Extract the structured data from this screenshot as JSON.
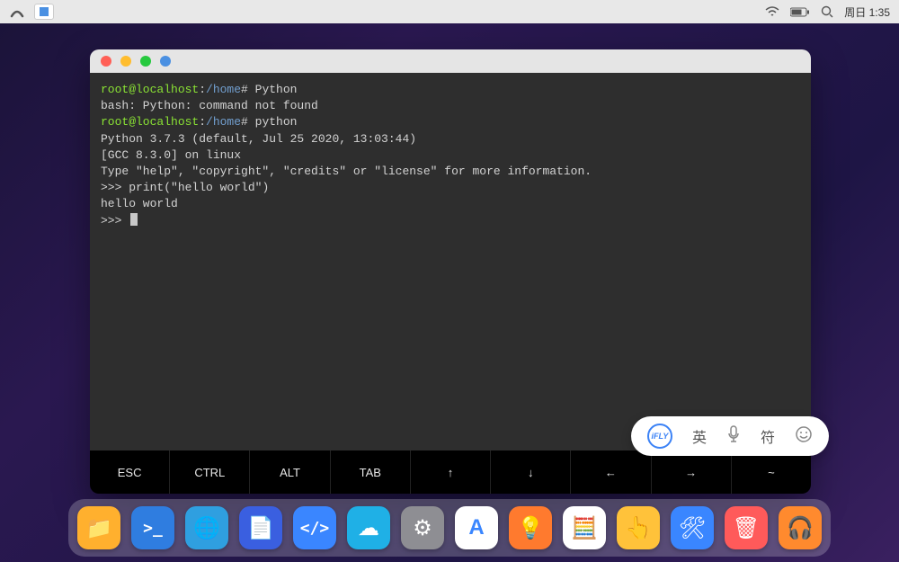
{
  "statusbar": {
    "time": "周日 1:35"
  },
  "terminal": {
    "line1_prompt_user": "root@localhost",
    "line1_prompt_sep": ":",
    "line1_prompt_path": "/home",
    "line1_prompt_sym": "# ",
    "line1_cmd": "Python",
    "line2": "bash: Python: command not found",
    "line3_cmd": "python",
    "line4": "Python 3.7.3 (default, Jul 25 2020, 13:03:44)",
    "line5": "[GCC 8.3.0] on linux",
    "line6": "Type \"help\", \"copyright\", \"credits\" or \"license\" for more information.",
    "line7_prompt": ">>> ",
    "line7_code": "print(\"hello world\")",
    "line8": "hello world",
    "line9_prompt": ">>> "
  },
  "keyboard": {
    "k1": "ESC",
    "k2": "CTRL",
    "k3": "ALT",
    "k4": "TAB",
    "k5": "↑",
    "k6": "↓",
    "k7": "←",
    "k8": "→",
    "k9": "~"
  },
  "ime": {
    "logo": "iFLY",
    "lang": "英",
    "sym": "符"
  },
  "dock": {
    "items": [
      {
        "name": "files",
        "bg": "#ffb02e",
        "glyph": "📁"
      },
      {
        "name": "terminal",
        "bg": "#2f7de0",
        "glyph": ">_"
      },
      {
        "name": "browser",
        "bg": "#2f9fe0",
        "glyph": "🌐"
      },
      {
        "name": "editor",
        "bg": "#3a5fe0",
        "glyph": "📄"
      },
      {
        "name": "devtool",
        "bg": "#3a86ff",
        "glyph": "</>"
      },
      {
        "name": "cloud",
        "bg": "#1fb0e6",
        "glyph": "☁"
      },
      {
        "name": "settings",
        "bg": "#8e8e93",
        "glyph": "⚙"
      },
      {
        "name": "appstore",
        "bg": "#ffffff",
        "glyph": "A"
      },
      {
        "name": "tips",
        "bg": "#ff7a2e",
        "glyph": "💡"
      },
      {
        "name": "calculator",
        "bg": "#ffffff",
        "glyph": "🧮"
      },
      {
        "name": "pointer",
        "bg": "#ffc23a",
        "glyph": "👆"
      },
      {
        "name": "tools",
        "bg": "#3a86ff",
        "glyph": "🛠"
      },
      {
        "name": "trash",
        "bg": "#ff5a5a",
        "glyph": "🗑"
      },
      {
        "name": "music",
        "bg": "#ff8a2e",
        "glyph": "🎧"
      }
    ]
  }
}
